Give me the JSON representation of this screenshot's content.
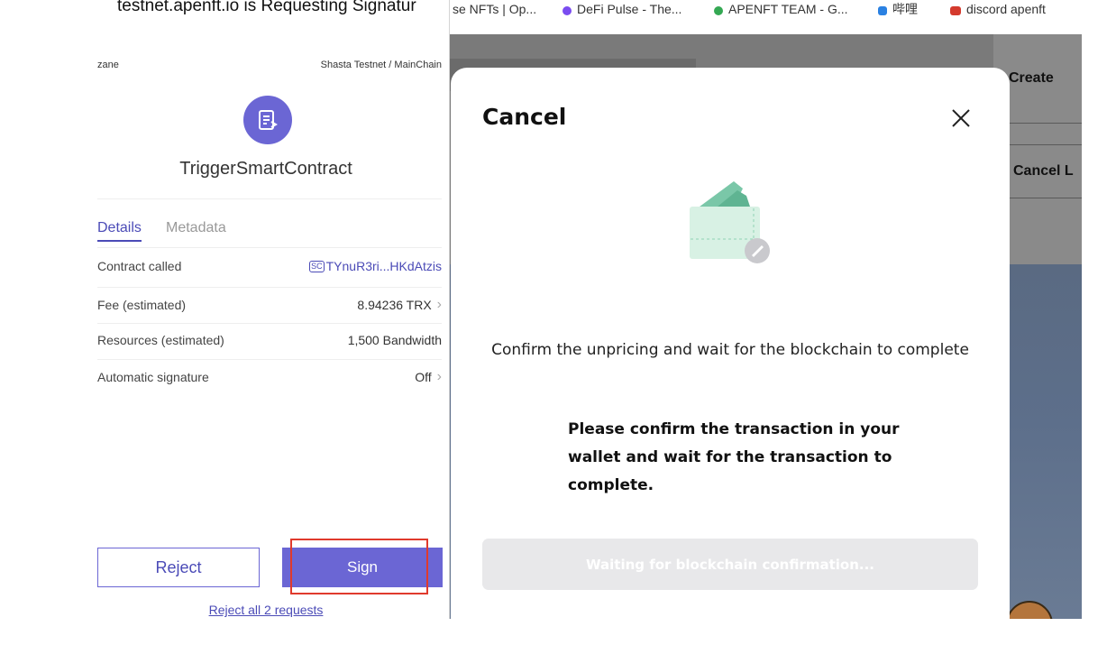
{
  "bookmarks": {
    "items": [
      {
        "label": "se NFTs | Op...",
        "icon": "nft-bookmark-icon",
        "color": "#2a81e2"
      },
      {
        "label": "DeFi Pulse - The...",
        "icon": "defi-pulse-icon",
        "color": "#7a4cf0"
      },
      {
        "label": "APENFT TEAM - G...",
        "icon": "google-drive-icon",
        "color": "#34a853"
      },
      {
        "label": "哔哩",
        "icon": "bilibili-icon",
        "color": "#2a81e2"
      },
      {
        "label": "discord apenft",
        "icon": "discord-icon",
        "color": "#d43a2d"
      }
    ]
  },
  "background_site": {
    "create_label": "Create",
    "cancel_label": "Cancel L"
  },
  "popup": {
    "window_title": "testnet.apenft.io is Requesting Signatur",
    "account": "zane",
    "network": "Shasta Testnet / MainChain",
    "contract_type": "TriggerSmartContract",
    "tabs": {
      "details": "Details",
      "metadata": "Metadata"
    },
    "rows": [
      {
        "label": "Contract called",
        "value": "TYnuR3ri...HKdAtzis",
        "badge": "SC"
      },
      {
        "label": "Fee (estimated)",
        "value": "8.94236 TRX"
      },
      {
        "label": "Resources (estimated)",
        "value": "1,500 Bandwidth"
      },
      {
        "label": "Automatic signature",
        "value": "Off"
      }
    ],
    "reject_label": "Reject",
    "sign_label": "Sign",
    "reject_all_label": "Reject all 2 requests",
    "accent_color": "#6b66d4",
    "highlight_color": "#e03a2d"
  },
  "modal": {
    "title": "Cancel",
    "message": "Confirm the unpricing and wait for the blockchain to complete",
    "instruction": "Please confirm the transaction in your wallet and wait for the transaction to complete.",
    "button_label": "Waiting for blockchain confirmation..."
  }
}
